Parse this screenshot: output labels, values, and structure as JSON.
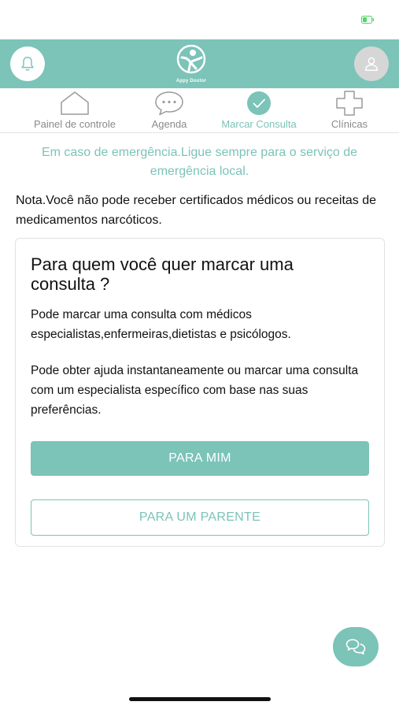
{
  "header": {
    "logo_text": "Appy Doutor"
  },
  "tabs": [
    {
      "label": "Painel de controle",
      "icon": "house-icon",
      "active": false
    },
    {
      "label": "Agenda",
      "icon": "chat-dots-icon",
      "active": false
    },
    {
      "label": "Marcar Consulta",
      "icon": "check-circle-icon",
      "active": true
    },
    {
      "label": "Clínicas",
      "icon": "cross-icon",
      "active": false
    }
  ],
  "notices": {
    "emergency": "Em caso de emergência.Ligue sempre para o serviço de emergência local.",
    "note": "Nota.Você não pode receber certificados médicos ou receitas de medicamentos narcóticos."
  },
  "card": {
    "title": "Para quem você quer marcar uma consulta ?",
    "paragraph1": "Pode marcar uma consulta com médicos especialistas,enfermeiras,dietistas e psicólogos.",
    "paragraph2": "Pode obter ajuda instantaneamente ou marcar uma consulta com um especialista específico com base nas suas preferências.",
    "primary_button": "PARA MIM",
    "secondary_button": "PARA UM PARENTE"
  },
  "colors": {
    "accent": "#7cc3b8",
    "battery": "#4cd964"
  }
}
